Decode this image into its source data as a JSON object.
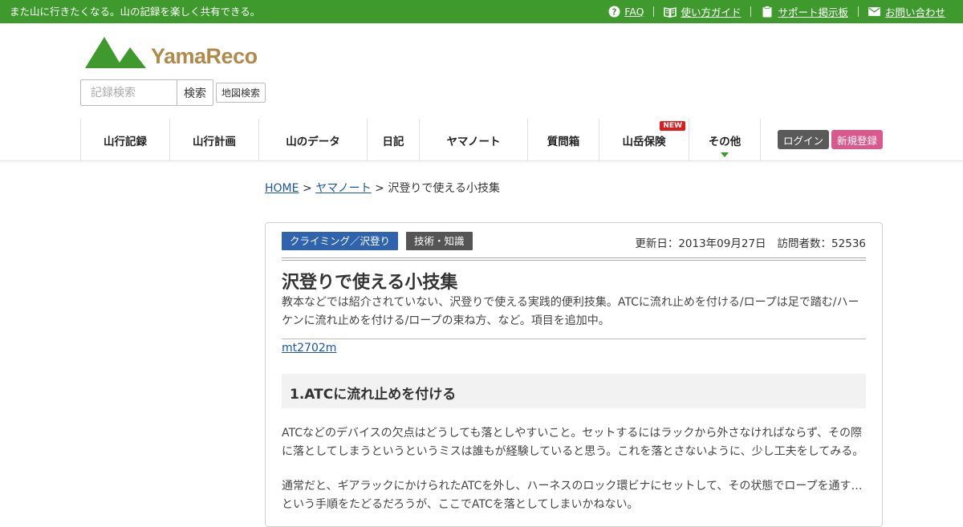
{
  "topbar": {
    "tagline": "また山に行きたくなる。山の記録を楽しく共有できる。",
    "links": [
      {
        "label": "FAQ",
        "icon": "help-circle-icon"
      },
      {
        "label": "使い方ガイド",
        "icon": "book-icon"
      },
      {
        "label": "サポート掲示板",
        "icon": "clipboard-icon"
      },
      {
        "label": "お問い合わせ",
        "icon": "mail-icon"
      }
    ]
  },
  "header": {
    "logo_text": "YamaReco",
    "search": {
      "placeholder": "記録検索",
      "button": "検索",
      "map_button": "地図検索"
    }
  },
  "nav": {
    "items": [
      {
        "label": "山行記録"
      },
      {
        "label": "山行計画"
      },
      {
        "label": "山のデータ"
      },
      {
        "label": "日記"
      },
      {
        "label": "ヤマノート"
      },
      {
        "label": "質問箱"
      },
      {
        "label": "山岳保険",
        "badge": "NEW"
      },
      {
        "label": "その他"
      }
    ],
    "login": "ログイン",
    "register": "新規登録"
  },
  "breadcrumb": {
    "home": "HOME",
    "sep1": ">",
    "section": "ヤマノート",
    "sep2": ">",
    "current": "沢登りで使える小技集"
  },
  "article": {
    "tags": [
      "クライミング／沢登り",
      "技術・知識"
    ],
    "updated": "更新日：2013年09月27日",
    "visitors": "訪問者数：52536",
    "title": "沢登りで使える小技集",
    "summary": "教本などでは紹介されていない、沢登りで使える実践的便利技集。ATCに流れ止めを付ける/ロープは足で踏む/ハーケンに流れ止めを付ける/ロープの束ね方、など。項目を追加中。",
    "author": "mt2702m",
    "section1_title": "1.ATCに流れ止めを付ける",
    "para1": "ATCなどのデバイスの欠点はどうしても落としやすいこと。セットするにはラックから外さなければならず、その際に落としてしまうというというミスは誰もが経験していると思う。これを落とさないように、少し工夫をしてみる。",
    "para2": "通常だと、ギアラックにかけられたATCを外し、ハーネスのロック環ビナにセットして、その状態でロープを通す…という手順をたどるだろうが、ここでATCを落としてしまいかねない。"
  },
  "colors": {
    "brand_green": "#3f9a2d",
    "logo_gold": "#b08a4a",
    "link_blue": "#1a56a8",
    "tag_blue": "#2f63ad",
    "register_pink": "#d9598c",
    "new_red": "#e01b1b"
  }
}
